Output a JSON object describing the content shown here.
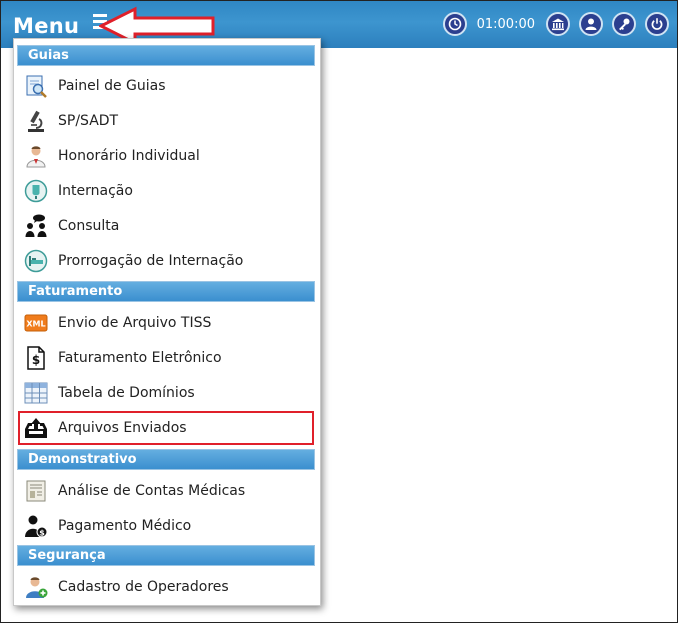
{
  "header": {
    "menu_label": "Menu",
    "timer": "01:00:00",
    "icons": [
      "clock-icon",
      "bank-icon",
      "user-icon",
      "key-icon",
      "power-icon"
    ]
  },
  "menu": {
    "sections": [
      {
        "title": "Guias",
        "items": [
          {
            "label": "Painel de Guias",
            "icon": "magnifier-document-icon"
          },
          {
            "label": "SP/SADT",
            "icon": "microscope-icon"
          },
          {
            "label": "Honorário Individual",
            "icon": "doctor-icon"
          },
          {
            "label": "Internação",
            "icon": "iv-bag-icon"
          },
          {
            "label": "Consulta",
            "icon": "consultation-icon"
          },
          {
            "label": "Prorrogação de Internação",
            "icon": "hospital-bed-icon"
          }
        ]
      },
      {
        "title": "Faturamento",
        "items": [
          {
            "label": "Envio de Arquivo TISS",
            "icon": "xml-icon"
          },
          {
            "label": "Faturamento Eletrônico",
            "icon": "dollar-document-icon"
          },
          {
            "label": "Tabela de Domínios",
            "icon": "table-icon"
          },
          {
            "label": "Arquivos Enviados",
            "icon": "outbox-icon"
          }
        ]
      },
      {
        "title": "Demonstrativo",
        "items": [
          {
            "label": "Análise de Contas Médicas",
            "icon": "invoice-icon"
          },
          {
            "label": "Pagamento Médico",
            "icon": "user-money-icon"
          }
        ]
      },
      {
        "title": "Segurança",
        "items": [
          {
            "label": "Cadastro de Operadores",
            "icon": "add-user-icon"
          }
        ]
      }
    ],
    "highlighted_item": "Arquivos Enviados"
  },
  "colors": {
    "topbar": "#3a8fcb",
    "section": "#4a9bd6",
    "highlight": "#e0202a",
    "arrow": "#e0202a"
  }
}
